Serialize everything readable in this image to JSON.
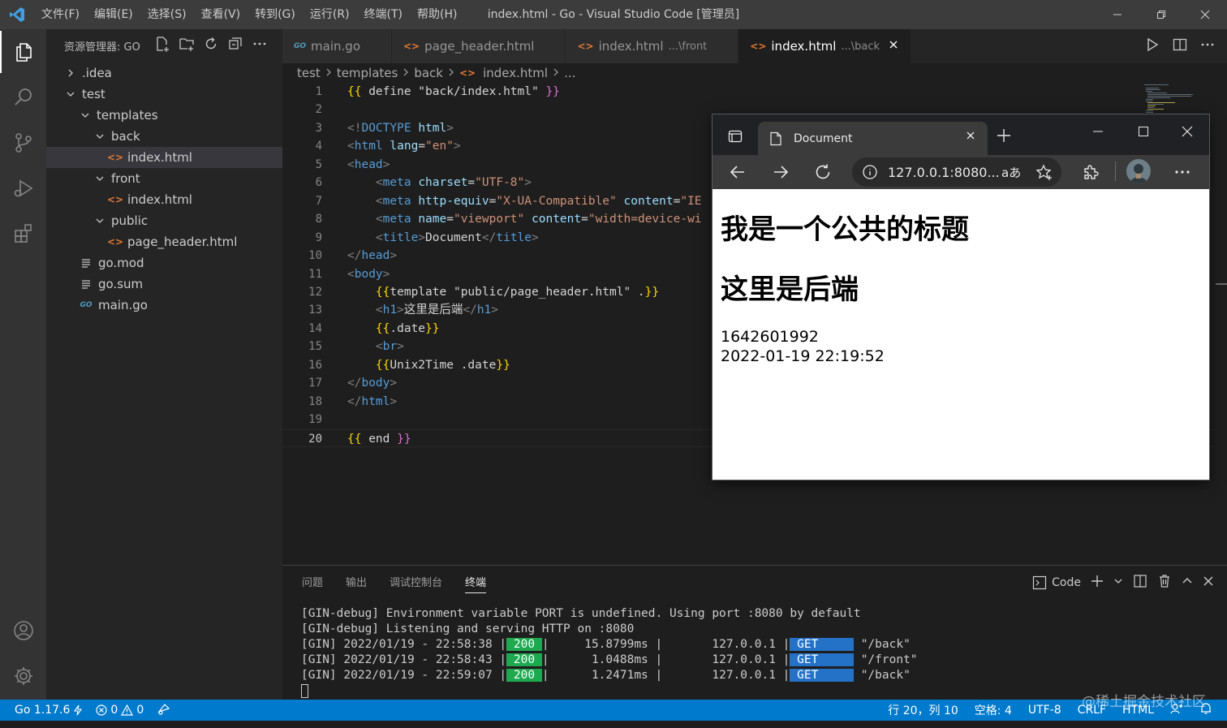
{
  "window": {
    "title": "index.html - Go - Visual Studio Code [管理员]",
    "menu": [
      "文件(F)",
      "编辑(E)",
      "选择(S)",
      "查看(V)",
      "转到(G)",
      "运行(R)",
      "终端(T)",
      "帮助(H)"
    ]
  },
  "sidebar": {
    "title": "资源管理器: GO",
    "tree": [
      {
        "label": ".idea",
        "depth": 0,
        "kind": "folder-collapsed"
      },
      {
        "label": "test",
        "depth": 0,
        "kind": "folder-open"
      },
      {
        "label": "templates",
        "depth": 1,
        "kind": "folder-open"
      },
      {
        "label": "back",
        "depth": 2,
        "kind": "folder-open"
      },
      {
        "label": "index.html",
        "depth": 3,
        "kind": "html",
        "selected": true
      },
      {
        "label": "front",
        "depth": 2,
        "kind": "folder-open"
      },
      {
        "label": "index.html",
        "depth": 3,
        "kind": "html"
      },
      {
        "label": "public",
        "depth": 2,
        "kind": "folder-open"
      },
      {
        "label": "page_header.html",
        "depth": 3,
        "kind": "html"
      },
      {
        "label": "go.mod",
        "depth": 1,
        "kind": "text"
      },
      {
        "label": "go.sum",
        "depth": 1,
        "kind": "text"
      },
      {
        "label": "main.go",
        "depth": 1,
        "kind": "go"
      }
    ]
  },
  "tabs": [
    {
      "label": "main.go",
      "desc": "",
      "icon": "go",
      "active": false
    },
    {
      "label": "page_header.html",
      "desc": "",
      "icon": "html",
      "active": false
    },
    {
      "label": "index.html",
      "desc": "...\\front",
      "icon": "html",
      "active": false
    },
    {
      "label": "index.html",
      "desc": "...\\back",
      "icon": "html",
      "active": true
    }
  ],
  "breadcrumb": [
    "test",
    "templates",
    "back",
    "index.html",
    "..."
  ],
  "editor": {
    "current_line": 20,
    "lines": [
      [
        [
          "{{",
          "tb"
        ],
        [
          " define \"back/index.html\" ",
          "tx"
        ],
        [
          "}}",
          "tp"
        ]
      ],
      [],
      [
        [
          "<!",
          "tg"
        ],
        [
          "DOCTYPE",
          "tn"
        ],
        [
          " ",
          "tx"
        ],
        [
          "html",
          "at"
        ],
        [
          ">",
          "tg"
        ]
      ],
      [
        [
          "<",
          "tg"
        ],
        [
          "html",
          "tn"
        ],
        [
          " ",
          "tx"
        ],
        [
          "lang",
          "at"
        ],
        [
          "=",
          "tx"
        ],
        [
          "\"en\"",
          "st"
        ],
        [
          ">",
          "tg"
        ]
      ],
      [
        [
          "<",
          "tg"
        ],
        [
          "head",
          "tn"
        ],
        [
          ">",
          "tg"
        ]
      ],
      [
        [
          "    ",
          "tx"
        ],
        [
          "<",
          "tg"
        ],
        [
          "meta",
          "tn"
        ],
        [
          " ",
          "tx"
        ],
        [
          "charset",
          "at"
        ],
        [
          "=",
          "tx"
        ],
        [
          "\"UTF-8\"",
          "st"
        ],
        [
          ">",
          "tg"
        ]
      ],
      [
        [
          "    ",
          "tx"
        ],
        [
          "<",
          "tg"
        ],
        [
          "meta",
          "tn"
        ],
        [
          " ",
          "tx"
        ],
        [
          "http-equiv",
          "at"
        ],
        [
          "=",
          "tx"
        ],
        [
          "\"X-UA-Compatible\"",
          "st"
        ],
        [
          " ",
          "tx"
        ],
        [
          "content",
          "at"
        ],
        [
          "=",
          "tx"
        ],
        [
          "\"IE",
          "st"
        ]
      ],
      [
        [
          "    ",
          "tx"
        ],
        [
          "<",
          "tg"
        ],
        [
          "meta",
          "tn"
        ],
        [
          " ",
          "tx"
        ],
        [
          "name",
          "at"
        ],
        [
          "=",
          "tx"
        ],
        [
          "\"viewport\"",
          "st"
        ],
        [
          " ",
          "tx"
        ],
        [
          "content",
          "at"
        ],
        [
          "=",
          "tx"
        ],
        [
          "\"width=device-wi",
          "st"
        ]
      ],
      [
        [
          "    ",
          "tx"
        ],
        [
          "<",
          "tg"
        ],
        [
          "title",
          "tn"
        ],
        [
          ">",
          "tg"
        ],
        [
          "Document",
          "tx"
        ],
        [
          "</",
          "tg"
        ],
        [
          "title",
          "tn"
        ],
        [
          ">",
          "tg"
        ]
      ],
      [
        [
          "</",
          "tg"
        ],
        [
          "head",
          "tn"
        ],
        [
          ">",
          "tg"
        ]
      ],
      [
        [
          "<",
          "tg"
        ],
        [
          "body",
          "tn"
        ],
        [
          ">",
          "tg"
        ]
      ],
      [
        [
          "    ",
          "tx"
        ],
        [
          "{{",
          "tb"
        ],
        [
          "template \"public/page_header.html\" .",
          "tx"
        ],
        [
          "}}",
          "tb"
        ]
      ],
      [
        [
          "    ",
          "tx"
        ],
        [
          "<",
          "tg"
        ],
        [
          "h1",
          "tn"
        ],
        [
          ">",
          "tg"
        ],
        [
          "这里是后端",
          "tx"
        ],
        [
          "</",
          "tg"
        ],
        [
          "h1",
          "tn"
        ],
        [
          ">",
          "tg"
        ]
      ],
      [
        [
          "    ",
          "tx"
        ],
        [
          "{{",
          "tb"
        ],
        [
          ".date",
          "tx"
        ],
        [
          "}}",
          "tb"
        ]
      ],
      [
        [
          "    ",
          "tx"
        ],
        [
          "<",
          "tg"
        ],
        [
          "br",
          "tn"
        ],
        [
          ">",
          "tg"
        ]
      ],
      [
        [
          "    ",
          "tx"
        ],
        [
          "{{",
          "tb"
        ],
        [
          "Unix2Time .date",
          "tx"
        ],
        [
          "}}",
          "tb"
        ]
      ],
      [
        [
          "</",
          "tg"
        ],
        [
          "body",
          "tn"
        ],
        [
          ">",
          "tg"
        ]
      ],
      [
        [
          "</",
          "tg"
        ],
        [
          "html",
          "tn"
        ],
        [
          ">",
          "tg"
        ]
      ],
      [],
      [
        [
          "{{",
          "tb"
        ],
        [
          " end ",
          "tx"
        ],
        [
          "}}",
          "tp"
        ]
      ]
    ]
  },
  "panel": {
    "tabs": [
      "问题",
      "输出",
      "调试控制台",
      "终端"
    ],
    "active_tab": "终端",
    "shell_label": "Code",
    "terminal_text": [
      "[GIN-debug] Environment variable PORT is undefined. Using port :8080 by default",
      "[GIN-debug] Listening and serving HTTP on :8080"
    ],
    "requests": [
      {
        "prefix": "[GIN] 2022/01/19 - 22:58:38 |",
        "status": " 200 ",
        "latency": "     15.8799ms |",
        "ip": "       127.0.0.1 |",
        "method": " GET     ",
        "path": " \"/back\""
      },
      {
        "prefix": "[GIN] 2022/01/19 - 22:58:43 |",
        "status": " 200 ",
        "latency": "      1.0488ms |",
        "ip": "       127.0.0.1 |",
        "method": " GET     ",
        "path": " \"/front\""
      },
      {
        "prefix": "[GIN] 2022/01/19 - 22:59:07 |",
        "status": " 200 ",
        "latency": "      1.2471ms |",
        "ip": "       127.0.0.1 |",
        "method": " GET     ",
        "path": " \"/back\""
      }
    ]
  },
  "statusbar": {
    "go_version": "Go 1.17.6",
    "errors": "0",
    "warnings": "0",
    "position": "行 20，列 10",
    "indent": "空格: 4",
    "encoding": "UTF-8",
    "eol": "CRLF",
    "language": "HTML"
  },
  "watermark": "@稀土掘金技术社区",
  "browser": {
    "tab_title": "Document",
    "url": "127.0.0.1:8080...",
    "page": {
      "heading_common": "我是一个公共的标题",
      "heading_back": "这里是后端",
      "timestamp": "1642601992",
      "datetime": "2022-01-19 22:19:52"
    }
  },
  "colors": {
    "accent": "#007acc",
    "status_ok": "#1fa84f",
    "method_get": "#2472c8"
  }
}
